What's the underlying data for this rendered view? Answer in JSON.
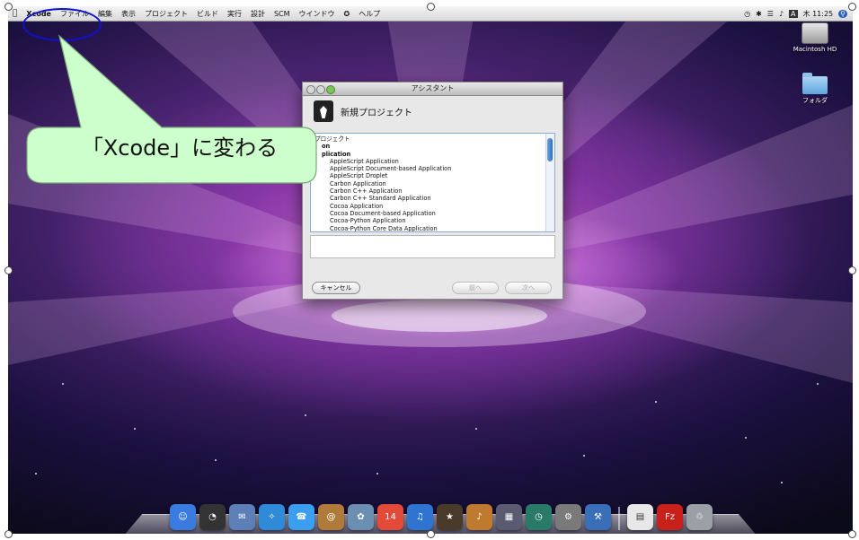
{
  "menubar": {
    "apple": "",
    "app_name": "Xcode",
    "items": [
      "ファイル",
      "編集",
      "表示",
      "プロジェクト",
      "ビルド",
      "実行",
      "設計",
      "SCM",
      "ウインドウ",
      "ヘルプ"
    ],
    "clock": "木 11:25",
    "input_menu": "A"
  },
  "desktop": {
    "icons": [
      {
        "label": "Macintosh HD",
        "icon": "hard-disk-icon"
      },
      {
        "label": "フォルダ",
        "icon": "folder-icon"
      }
    ]
  },
  "window": {
    "title": "アシスタント",
    "heading": "新規プロジェクト",
    "list": [
      {
        "text": "プロジェクト",
        "kind": "top"
      },
      {
        "text": "on",
        "kind": "cat"
      },
      {
        "text": "plication",
        "kind": "cat"
      },
      {
        "text": "AppleScript Application",
        "kind": "item"
      },
      {
        "text": "AppleScript Document-based Application",
        "kind": "item"
      },
      {
        "text": "AppleScript Droplet",
        "kind": "item"
      },
      {
        "text": "Carbon Application",
        "kind": "item"
      },
      {
        "text": "Carbon C++ Application",
        "kind": "item"
      },
      {
        "text": "Carbon C++ Standard Application",
        "kind": "item"
      },
      {
        "text": "Cocoa Application",
        "kind": "item"
      },
      {
        "text": "Cocoa Document-based Application",
        "kind": "item"
      },
      {
        "text": "Cocoa-Python Application",
        "kind": "item"
      },
      {
        "text": "Cocoa-Python Core Data Application",
        "kind": "item"
      }
    ],
    "buttons": {
      "cancel": "キャンセル",
      "prev": "前へ",
      "next": "次へ"
    }
  },
  "dock": {
    "items": [
      {
        "name": "finder-icon",
        "color": "#3a7be0",
        "glyph": "☺"
      },
      {
        "name": "dashboard-icon",
        "color": "#333333",
        "glyph": "◔"
      },
      {
        "name": "mail-icon",
        "color": "#5d7fb8",
        "glyph": "✉"
      },
      {
        "name": "safari-icon",
        "color": "#2f8ad8",
        "glyph": "✧"
      },
      {
        "name": "ichat-icon",
        "color": "#3b9ef0",
        "glyph": "☎"
      },
      {
        "name": "address-book-icon",
        "color": "#b07a3a",
        "glyph": "@"
      },
      {
        "name": "iphoto-icon",
        "color": "#6a8fb0",
        "glyph": "✿"
      },
      {
        "name": "ical-icon",
        "color": "#e44a3a",
        "glyph": "14"
      },
      {
        "name": "itunes-icon",
        "color": "#2e74d0",
        "glyph": "♫"
      },
      {
        "name": "imovie-icon",
        "color": "#4a3a2a",
        "glyph": "★"
      },
      {
        "name": "garageband-icon",
        "color": "#c07a30",
        "glyph": "♪"
      },
      {
        "name": "spaces-icon",
        "color": "#5a5a70",
        "glyph": "▦"
      },
      {
        "name": "time-machine-icon",
        "color": "#2a7a6a",
        "glyph": "◷"
      },
      {
        "name": "system-preferences-icon",
        "color": "#7a7a7a",
        "glyph": "⚙"
      },
      {
        "name": "xcode-icon",
        "color": "#3a6fb8",
        "glyph": "⚒"
      },
      {
        "name": "document-icon",
        "color": "#e8e8e8",
        "glyph": "▤"
      },
      {
        "name": "filezilla-icon",
        "color": "#c8201a",
        "glyph": "Fz"
      },
      {
        "name": "trash-icon",
        "color": "#9aa0a6",
        "glyph": "♲"
      }
    ]
  },
  "callout": {
    "text": "「Xcode」に変わる",
    "fill": "#ccffcc",
    "oval_color": "#1010d0"
  }
}
